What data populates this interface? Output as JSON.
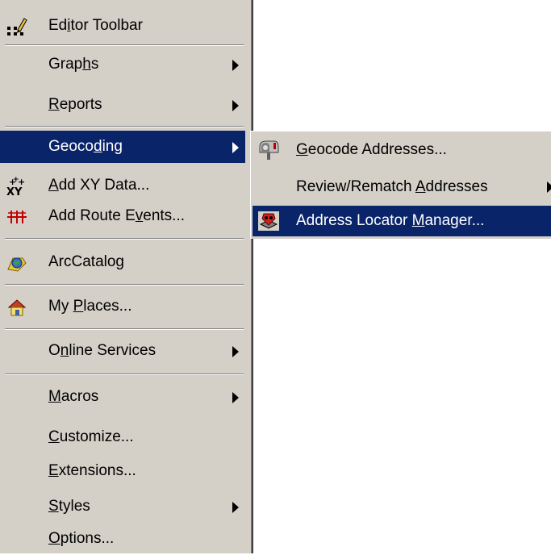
{
  "main_menu": {
    "editor_toolbar": {
      "pre": "Ed",
      "u": "i",
      "post": "tor Toolbar"
    },
    "graphs": {
      "pre": "Grap",
      "u": "h",
      "post": "s"
    },
    "reports": {
      "pre": "",
      "u": "R",
      "post": "eports"
    },
    "geocoding": {
      "pre": "Geoco",
      "u": "d",
      "post": "ing"
    },
    "add_xy_data": {
      "pre": "",
      "u": "A",
      "post": "dd XY Data..."
    },
    "add_route_events": {
      "pre": "Add Route E",
      "u": "v",
      "post": "ents..."
    },
    "arccatalog": {
      "pre": "ArcCatalo",
      "u": "g",
      "post": ""
    },
    "my_places": {
      "pre": "My ",
      "u": "P",
      "post": "laces..."
    },
    "online_services": {
      "pre": "O",
      "u": "n",
      "post": "line Services"
    },
    "macros": {
      "pre": "",
      "u": "M",
      "post": "acros"
    },
    "customize": {
      "pre": "",
      "u": "C",
      "post": "ustomize..."
    },
    "extensions": {
      "pre": "",
      "u": "E",
      "post": "xtensions..."
    },
    "styles": {
      "pre": "",
      "u": "S",
      "post": "tyles"
    },
    "options": {
      "pre": "",
      "u": "O",
      "post": "ptions..."
    }
  },
  "geocoding_submenu": {
    "geocode_addresses": {
      "pre": "",
      "u": "G",
      "post": "eocode Addresses..."
    },
    "review_rematch": {
      "pre": "Review/Rematch ",
      "u": "A",
      "post": "ddresses"
    },
    "locator_manager": {
      "pre": "Address Locator ",
      "u": "M",
      "post": "anager..."
    }
  },
  "colors": {
    "menu_bg": "#d4d0c8",
    "highlight": "#0a246a",
    "highlight_text": "#ffffff"
  }
}
